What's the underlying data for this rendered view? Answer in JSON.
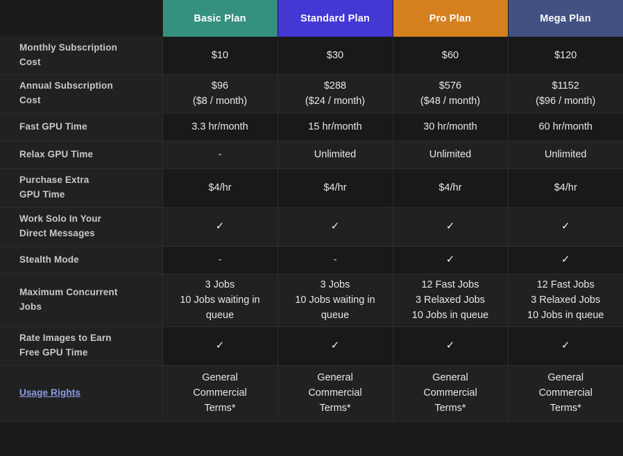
{
  "table": {
    "feature_column_header": "",
    "plans": [
      {
        "name": "Basic Plan",
        "color": "#36907f"
      },
      {
        "name": "Standard Plan",
        "color": "#4338d4"
      },
      {
        "name": "Pro Plan",
        "color": "#d5801f"
      },
      {
        "name": "Mega Plan",
        "color": "#435182"
      }
    ],
    "link_color": "#8f9eea",
    "rows": [
      {
        "label": "Monthly Subscription Cost",
        "label_lines": [
          "Monthly Subscription",
          "Cost"
        ],
        "values": [
          [
            "$10"
          ],
          [
            "$30"
          ],
          [
            "$60"
          ],
          [
            "$120"
          ]
        ]
      },
      {
        "label": "Annual Subscription Cost",
        "label_lines": [
          "Annual Subscription",
          "Cost"
        ],
        "values": [
          [
            "$96",
            "($8 / month)"
          ],
          [
            "$288",
            "($24 / month)"
          ],
          [
            "$576",
            "($48 / month)"
          ],
          [
            "$1152",
            "($96 / month)"
          ]
        ]
      },
      {
        "label": "Fast GPU Time",
        "label_lines": [
          "Fast GPU Time"
        ],
        "values": [
          [
            "3.3 hr/month"
          ],
          [
            "15 hr/month"
          ],
          [
            "30 hr/month"
          ],
          [
            "60 hr/month"
          ]
        ]
      },
      {
        "label": "Relax GPU Time",
        "label_lines": [
          "Relax GPU Time"
        ],
        "values": [
          [
            "-"
          ],
          [
            "Unlimited"
          ],
          [
            "Unlimited"
          ],
          [
            "Unlimited"
          ]
        ]
      },
      {
        "label": "Purchase Extra GPU Time",
        "label_lines": [
          "Purchase Extra",
          "GPU Time"
        ],
        "values": [
          [
            "$4/hr"
          ],
          [
            "$4/hr"
          ],
          [
            "$4/hr"
          ],
          [
            "$4/hr"
          ]
        ]
      },
      {
        "label": "Work Solo In Your Direct Messages",
        "label_lines": [
          "Work Solo In Your",
          "Direct Messages"
        ],
        "values": [
          [
            "✓"
          ],
          [
            "✓"
          ],
          [
            "✓"
          ],
          [
            "✓"
          ]
        ]
      },
      {
        "label": "Stealth Mode",
        "label_lines": [
          "Stealth Mode"
        ],
        "values": [
          [
            "-"
          ],
          [
            "-"
          ],
          [
            "✓"
          ],
          [
            "✓"
          ]
        ]
      },
      {
        "label": "Maximum Concurrent Jobs",
        "label_lines": [
          "Maximum Concurrent",
          "Jobs"
        ],
        "values": [
          [
            "3 Jobs",
            "10 Jobs waiting in queue"
          ],
          [
            "3 Jobs",
            "10 Jobs waiting in queue"
          ],
          [
            "12 Fast Jobs",
            "3 Relaxed Jobs",
            "10 Jobs in queue"
          ],
          [
            "12 Fast Jobs",
            "3 Relaxed Jobs",
            "10 Jobs in queue"
          ]
        ]
      },
      {
        "label": "Rate Images to Earn Free GPU Time",
        "label_lines": [
          "Rate Images to Earn",
          "Free GPU Time"
        ],
        "values": [
          [
            "✓"
          ],
          [
            "✓"
          ],
          [
            "✓"
          ],
          [
            "✓"
          ]
        ]
      },
      {
        "label": "Usage Rights",
        "label_lines": [
          "Usage Rights"
        ],
        "label_is_link": true,
        "values": [
          [
            "General",
            "Commercial",
            "Terms*"
          ],
          [
            "General",
            "Commercial",
            "Terms*"
          ],
          [
            "General",
            "Commercial",
            "Terms*"
          ],
          [
            "General",
            "Commercial",
            "Terms*"
          ]
        ]
      }
    ]
  }
}
